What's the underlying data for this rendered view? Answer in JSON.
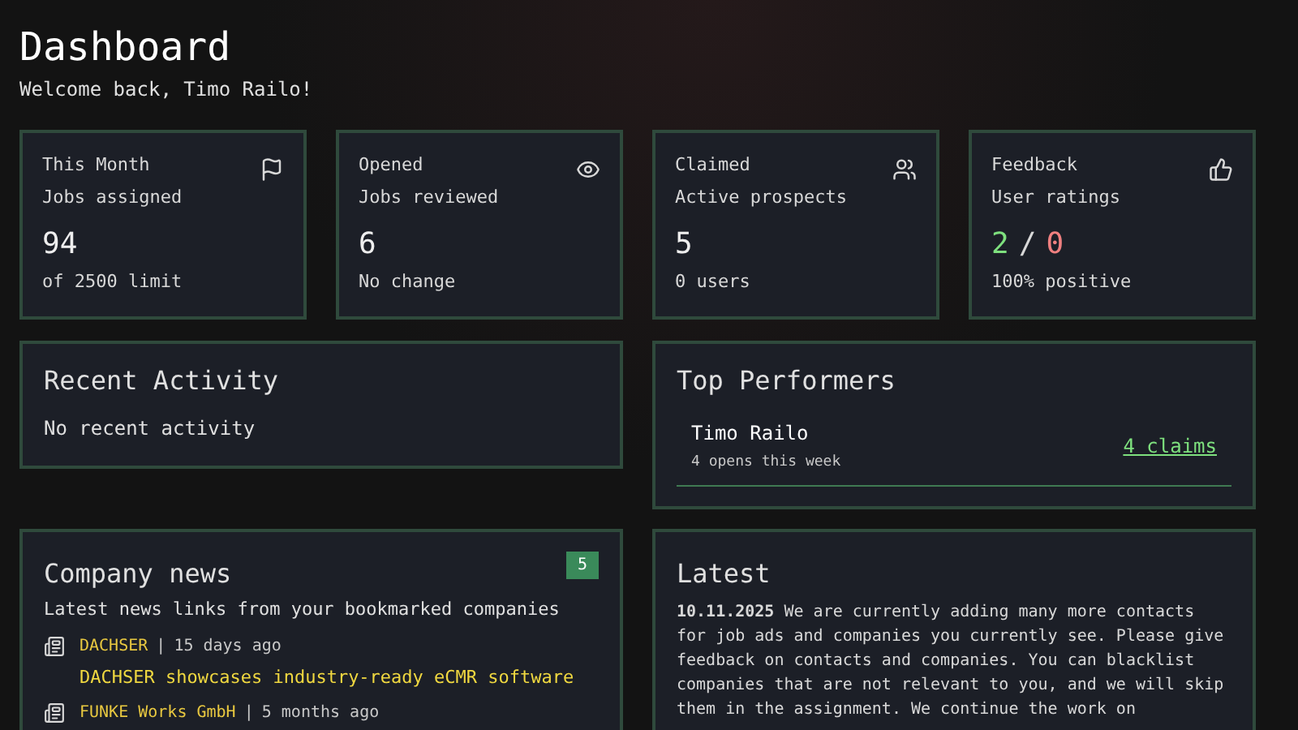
{
  "header": {
    "title": "Dashboard",
    "subtitle": "Welcome back, Timo Railo!"
  },
  "stats": [
    {
      "kind": "count",
      "period": "This Month",
      "label": "Jobs assigned",
      "value": "94",
      "note": "of 2500 limit"
    },
    {
      "kind": "count",
      "period": "Opened",
      "label": "Jobs reviewed",
      "value": "6",
      "note": "No change"
    },
    {
      "kind": "count",
      "period": "Claimed",
      "label": "Active prospects",
      "value": "5",
      "note": "0 users"
    },
    {
      "kind": "ratio",
      "period": "Feedback",
      "label": "User ratings",
      "positive": "2",
      "separator": "/",
      "negative": "0",
      "note": "100% positive"
    }
  ],
  "recent_activity": {
    "title": "Recent Activity",
    "empty_text": "No recent activity"
  },
  "top_performers": {
    "title": "Top Performers",
    "rows": [
      {
        "name": "Timo Railo",
        "detail": "4 opens this week",
        "claims": "4 claims"
      }
    ]
  },
  "company_news": {
    "title": "Company news",
    "badge": "5",
    "subtitle": "Latest news links from your bookmarked companies",
    "items": [
      {
        "company": "DACHSER",
        "separator": "|",
        "age": "15 days ago",
        "headline": "DACHSER showcases industry-ready eCMR software"
      },
      {
        "company": "FUNKE Works GmbH",
        "separator": "|",
        "age": "5 months ago"
      }
    ]
  },
  "latest": {
    "title": "Latest",
    "text": "**10.11.2025** We are currently adding many more contacts for job ads and companies you currently see. Please give feedback on contacts and companies. You can blacklist companies that are not relevant to you, and we will skip them in the assignment. We continue the work on"
  }
}
